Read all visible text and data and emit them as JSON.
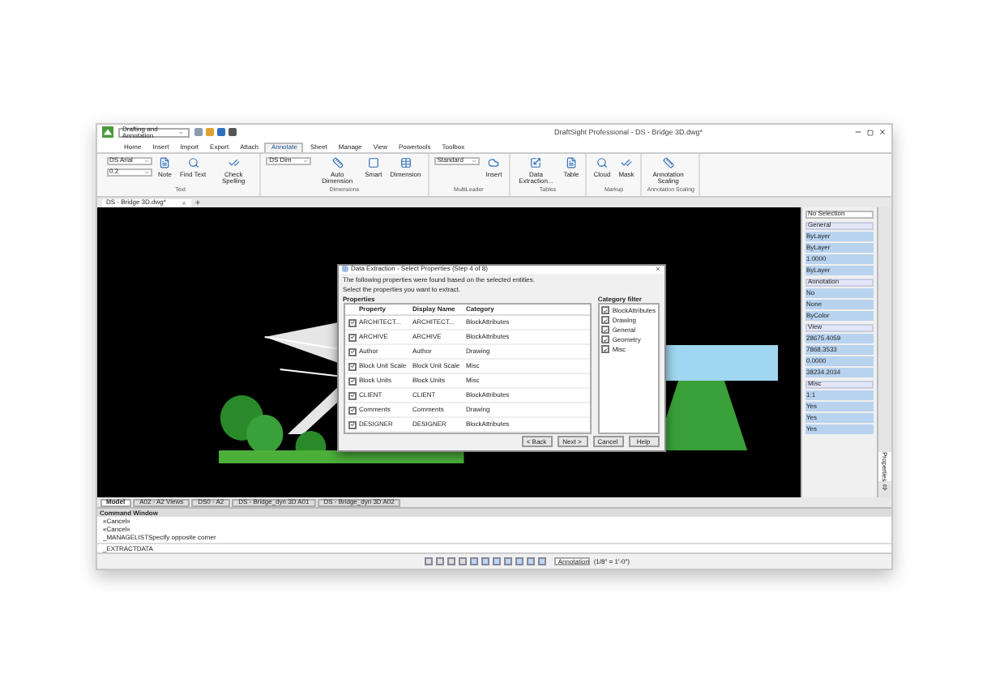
{
  "window": {
    "workspace": "Drafting and Annotation",
    "title": "DraftSight Professional - DS - Bridge 3D.dwg*"
  },
  "menu_tabs": [
    {
      "label": "Home",
      "selected": false
    },
    {
      "label": "Insert",
      "selected": false
    },
    {
      "label": "Import",
      "selected": false
    },
    {
      "label": "Export",
      "selected": false
    },
    {
      "label": "Attach",
      "selected": false
    },
    {
      "label": "Annotate",
      "selected": true
    },
    {
      "label": "Sheet",
      "selected": false
    },
    {
      "label": "Manage",
      "selected": false
    },
    {
      "label": "View",
      "selected": false
    },
    {
      "label": "Powertools",
      "selected": false
    },
    {
      "label": "Toolbox",
      "selected": false
    }
  ],
  "ribbon_groups": [
    {
      "title": "Text",
      "fields": [
        "DS Arial",
        "0.2"
      ],
      "buttons": [
        "Note",
        "Find Text",
        "Check Spelling"
      ]
    },
    {
      "title": "Dimensions",
      "fields": [
        "DS Dim"
      ],
      "buttons": [
        "Auto Dimension",
        "Smart",
        "Dimension"
      ]
    },
    {
      "title": "MultiLeader",
      "fields": [
        "Standard"
      ],
      "buttons": [
        "Insert"
      ]
    },
    {
      "title": "Tables",
      "buttons": [
        "Data Extraction...",
        "Table"
      ]
    },
    {
      "title": "Markup",
      "buttons": [
        "Cloud",
        "Mask"
      ]
    },
    {
      "title": "Annotation Scaling",
      "buttons": [
        "Annotation Scaling"
      ]
    }
  ],
  "doc_tabs": [
    {
      "label": "DS - Bridge 3D.dwg*",
      "selected": true
    }
  ],
  "dialog": {
    "title": "Data Extraction - Select Properties (Step 4 of 8)",
    "intro": "The following properties were found based on the selected entities.",
    "instruction": "Select the properties you want to extract.",
    "properties_label": "Properties",
    "columns": [
      "Property",
      "Display Name",
      "Category"
    ],
    "rows": [
      {
        "cells": [
          "ARCHITECT...",
          "ARCHITECT...",
          "BlockAttributes"
        ],
        "checked": true
      },
      {
        "cells": [
          "ARCHIVE",
          "ARCHIVE",
          "BlockAttributes"
        ],
        "checked": true
      },
      {
        "cells": [
          "Author",
          "Author",
          "Drawing"
        ],
        "checked": true
      },
      {
        "cells": [
          "Block Unit Scale",
          "Block Unit Scale",
          "Misc"
        ],
        "checked": true
      },
      {
        "cells": [
          "Block Units",
          "Block Units",
          "Misc"
        ],
        "checked": true
      },
      {
        "cells": [
          "CLIENT",
          "CLIENT",
          "BlockAttributes"
        ],
        "checked": true
      },
      {
        "cells": [
          "Comments",
          "Comments",
          "Drawing"
        ],
        "checked": true
      },
      {
        "cells": [
          "DESIGNER",
          "DESIGNER",
          "BlockAttributes"
        ],
        "checked": true
      }
    ],
    "filter_label": "Category filter",
    "categories": [
      {
        "label": "BlockAttributes",
        "checked": true
      },
      {
        "label": "Drawing",
        "checked": true
      },
      {
        "label": "General",
        "checked": true
      },
      {
        "label": "Geometry",
        "checked": true
      },
      {
        "label": "Misc",
        "checked": true
      }
    ],
    "buttons": [
      "< Back",
      "Next >",
      "Cancel",
      "Help"
    ]
  },
  "properties_panel": {
    "selection": "No Selection",
    "sections": [
      {
        "title": "General",
        "fields": [
          "ByLayer",
          "ByLayer",
          "1.0000",
          "ByLayer"
        ]
      },
      {
        "title": "Annotation",
        "fields": [
          "No",
          "None",
          "ByColor"
        ]
      },
      {
        "title": "View",
        "fields": [
          "28675.4059",
          "7868.3533",
          "0.0000",
          "38234.2034"
        ]
      },
      {
        "title": "Misc",
        "fields": [
          "1:1",
          "Yes",
          "Yes",
          "Yes"
        ]
      }
    ],
    "side_tabs": [
      {
        "label": "Properties",
        "selected": true
      }
    ]
  },
  "sheet_tabs": [
    {
      "label": "Model",
      "selected": true
    },
    {
      "label": "A02 - A2 Views",
      "selected": false
    },
    {
      "label": "DS0 - A2",
      "selected": false
    },
    {
      "label": "DS - Bridge_dyn 3D A01",
      "selected": false
    },
    {
      "label": "DS - Bridge_dyn 3D A02",
      "selected": false
    }
  ],
  "command_window": {
    "title": "Command Window",
    "lines": [
      "«Cancel»",
      "«Cancel»",
      "_MANAGELISTSpecify opposite corner"
    ],
    "input": "_EXTRACTDATA"
  },
  "status_bar": {
    "annotation": "Annotation",
    "scale": "(1/8\" = 1'-0\")"
  }
}
